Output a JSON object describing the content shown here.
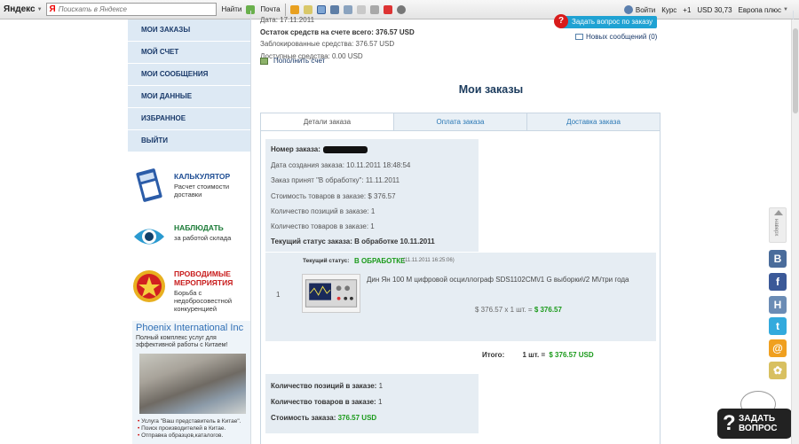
{
  "toolbar": {
    "logo": "Яндекс",
    "search_placeholder": "Поискать в Яндексе",
    "find": "Найти",
    "mail": "Почта",
    "enter": "Войти",
    "rate_label": "Курс",
    "counter": "+1",
    "usd": "USD 30,73",
    "radio": "Европа плюс"
  },
  "sidebar": {
    "items": [
      {
        "label": "МОИ ЗАКАЗЫ"
      },
      {
        "label": "МОЙ СЧЕТ"
      },
      {
        "label": "МОИ СООБЩЕНИЯ"
      },
      {
        "label": "МОИ ДАННЫЕ"
      },
      {
        "label": "ИЗБРАННОЕ"
      },
      {
        "label": "ВЫЙТИ"
      }
    ],
    "promos": [
      {
        "title": "КАЛЬКУЛЯТОР",
        "subtitle": "Расчет стоимости доставки",
        "color": "#1f4e94"
      },
      {
        "title": "НАБЛЮДАТЬ",
        "subtitle": "за работой склада",
        "color": "#1a7a36"
      },
      {
        "title": "ПРОВОДИМЫЕ МЕРОПРИЯТИЯ",
        "subtitle": "Борьба с недобросовестной конкуренцией",
        "color": "#c81c1c"
      }
    ],
    "phoenix": {
      "title": "Phoenix International Inc",
      "subtitle": "Полный комплекс услуг для эффективной работы с Китаем!",
      "bullets": [
        "Услуга \"Ваш представитель в Китае\".",
        "Поиск производителей в Китае.",
        "Отправка образцов,каталогов."
      ]
    }
  },
  "account": {
    "date": "Дата: 17.11.2011",
    "balance_total": "Остаток средств на счете всего: 376.57 USD",
    "blocked": "Заблокированные средства: 376.57 USD",
    "available": "Доступные средства: 0.00 USD",
    "topup": "Пополнить счет"
  },
  "ask_button": "Задать вопрос по заказу",
  "new_messages": "Новых сообщений (0)",
  "page_title": "Мои заказы",
  "tabs": [
    {
      "label": "Детали заказа",
      "active": true
    },
    {
      "label": "Оплата заказа",
      "active": false
    },
    {
      "label": "Доставка заказа",
      "active": false
    }
  ],
  "order": {
    "number_label": "Номер заказа:",
    "created": "Дата создания заказа: 10.11.2011 18:48:54",
    "accepted": "Заказ принят \"В обработку\": 11.11.2011",
    "goods_cost": "Стоимость товаров в заказе: $ 376.57",
    "positions": "Количество позиций в заказе: 1",
    "goods_count": "Количество товаров в заказе: 1",
    "status": "Текущий статус заказа: В обработке 10.11.2011"
  },
  "item": {
    "index": "1",
    "status_label": "Текущий статус:",
    "status_value": "В ОБРАБОТКЕ",
    "status_date": "(11.11.2011 16:25:06)",
    "name": "Дин Ян 100 М цифровой осциллограф SDS1102CM\\/1 G выборки\\/2 M\\/три года",
    "price_line": "$ 376.57 x 1 шт. =",
    "price_sum": "$ 376.57"
  },
  "total": {
    "label": "Итого:",
    "qty": "1 шт. =",
    "sum": "$ 376.57 USD"
  },
  "summary": {
    "positions_label": "Количество позиций в заказе:",
    "positions": "1",
    "goods_label": "Количество товаров в заказе:",
    "goods": "1",
    "cost_label": "Стоимость заказа:",
    "cost": "376.57 USD"
  },
  "social": {
    "top_label": "наверх",
    "buttons": [
      {
        "glyph": "В",
        "color": "#4a6c9b"
      },
      {
        "glyph": "f",
        "color": "#3b5998"
      },
      {
        "glyph": "H",
        "color": "#6b8cb5"
      },
      {
        "glyph": "t",
        "color": "#33aadd"
      },
      {
        "glyph": "@",
        "color": "#f0a020"
      },
      {
        "glyph": "✿",
        "color": "#d8c060"
      }
    ]
  },
  "question_badge": {
    "mark": "?",
    "text": "ЗАДАТЬ ВОПРОС"
  }
}
